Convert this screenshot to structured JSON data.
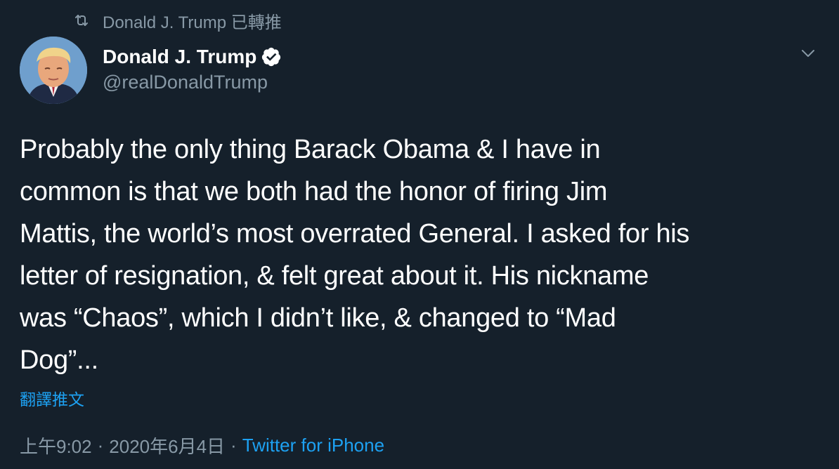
{
  "retweet": {
    "icon": "retweet-icon",
    "text": "Donald J. Trump 已轉推"
  },
  "author": {
    "display_name": "Donald J. Trump",
    "verified_icon": "verified-badge-icon",
    "handle": "@realDonaldTrump"
  },
  "menu": {
    "icon": "chevron-down-icon"
  },
  "tweet": {
    "lines": [
      "Probably the only thing Barack Obama & I have in",
      "common is that we both had the honor of firing Jim",
      "Mattis, the world’s most overrated General. I asked for his",
      "letter of resignation, & felt great about it. His nickname",
      "was “Chaos”, which I didn’t like, & changed to “Mad",
      "Dog”..."
    ]
  },
  "translate": {
    "label": "翻譯推文"
  },
  "meta": {
    "time": "上午9:02",
    "separator": "·",
    "date": "2020年6月4日",
    "source": "Twitter for iPhone"
  },
  "colors": {
    "background": "#15202b",
    "secondary_text": "#8899a6",
    "accent": "#1da1f2",
    "primary_text": "#ffffff"
  }
}
